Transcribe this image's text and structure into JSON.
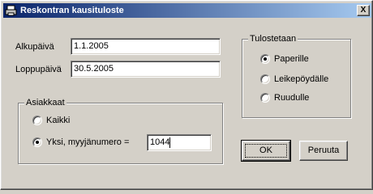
{
  "window": {
    "title": "Reskontran kausituloste",
    "close_label": "X",
    "icon": "printer-app-icon"
  },
  "fields": {
    "start_label": "Alkupäivä",
    "start_value": "1.1.2005",
    "end_label": "Loppupäivä",
    "end_value": "30.5.2005"
  },
  "customers": {
    "title": "Asiakkaat",
    "all_label": "Kaikki",
    "all_selected": false,
    "one_label": "Yksi, myyjänumero =",
    "one_selected": true,
    "seller_value": "1044"
  },
  "output": {
    "title": "Tulostetaan",
    "options": [
      {
        "label": "Paperille",
        "selected": true
      },
      {
        "label": "Leikepöydälle",
        "selected": false
      },
      {
        "label": "Ruudulle",
        "selected": false
      }
    ]
  },
  "buttons": {
    "ok_label": "OK",
    "cancel_label": "Peruuta"
  }
}
